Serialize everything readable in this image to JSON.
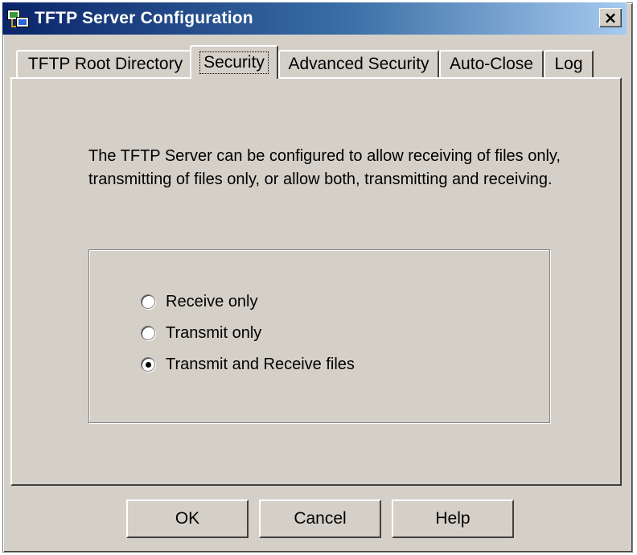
{
  "window": {
    "title": "TFTP Server Configuration",
    "close_symbol": "×",
    "app_icon": "network-computers-icon"
  },
  "tabs": [
    {
      "label": "TFTP Root Directory",
      "active": false
    },
    {
      "label": "Security",
      "active": true
    },
    {
      "label": "Advanced Security",
      "active": false
    },
    {
      "label": "Auto-Close",
      "active": false
    },
    {
      "label": "Log",
      "active": false
    }
  ],
  "security": {
    "description": "The TFTP Server can be configured to allow receiving of files only, transmitting of files only, or allow both, transmitting and receiving.",
    "options": [
      {
        "label": "Receive only",
        "checked": false
      },
      {
        "label": "Transmit only",
        "checked": false
      },
      {
        "label": "Transmit and Receive files",
        "checked": true
      }
    ]
  },
  "buttons": {
    "ok": "OK",
    "cancel": "Cancel",
    "help": "Help"
  }
}
